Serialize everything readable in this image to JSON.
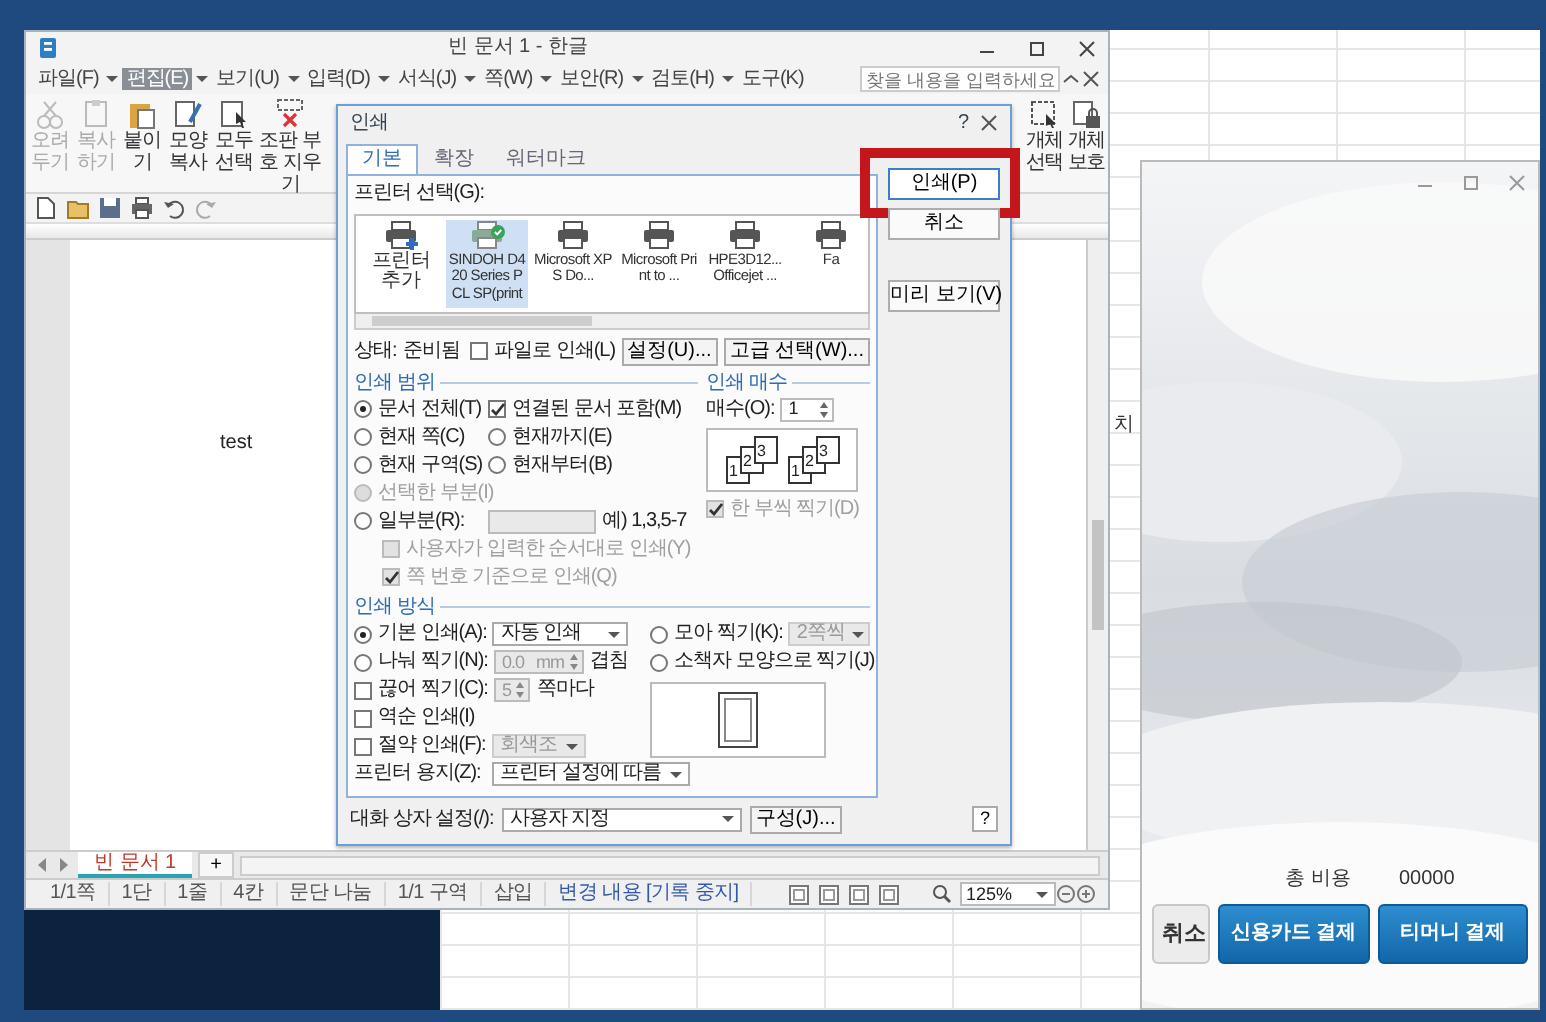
{
  "editor": {
    "title": "빈 문서 1 - 한글",
    "menu": [
      {
        "label": "파일(F)",
        "selected": false
      },
      {
        "label": "편집(E)",
        "selected": true
      },
      {
        "label": "보기(U)",
        "selected": false
      },
      {
        "label": "입력(D)",
        "selected": false
      },
      {
        "label": "서식(J)",
        "selected": false
      },
      {
        "label": "쪽(W)",
        "selected": false
      },
      {
        "label": "보안(R)",
        "selected": false
      },
      {
        "label": "검토(H)",
        "selected": false
      },
      {
        "label": "도구(K)",
        "selected": false
      }
    ],
    "search": {
      "placeholder": "찾을 내용을 입력하세요"
    },
    "ribbon_left": [
      {
        "label": "오려 두기",
        "disabled": true
      },
      {
        "label": "복사하기",
        "disabled": true
      },
      {
        "label": "붙이기",
        "disabled": false
      },
      {
        "label": "모양 복사",
        "disabled": false
      },
      {
        "label": "모두 선택",
        "disabled": false
      },
      {
        "label": "조판 부호 지우기",
        "disabled": false
      }
    ],
    "ribbon_right": [
      {
        "label": "개체 선택",
        "disabled": false
      },
      {
        "label": "개체 보호",
        "disabled": false
      }
    ],
    "document_text": "test",
    "doc_tabs": [
      {
        "label": "빈 문서 1",
        "selected": true
      }
    ],
    "new_tab_button": "+",
    "status_bar": [
      "1/1쪽",
      "1단",
      "1줄",
      "4칸",
      "문단 나눔",
      "1/1 구역",
      "삽입",
      "변경 내용 [기록 중지]"
    ],
    "zoom": "125%"
  },
  "print_dialog": {
    "title": "인쇄",
    "title_help": "?",
    "tabs": [
      {
        "label": "기본",
        "selected": true
      },
      {
        "label": "확장",
        "selected": false
      },
      {
        "label": "워터마크",
        "selected": false
      }
    ],
    "buttons": [
      {
        "label": "인쇄(P)",
        "highlighted": true
      },
      {
        "label": "취소",
        "highlighted": false
      },
      {
        "label": "미리 보기(V)",
        "highlighted": false
      }
    ],
    "printer_label": "프린터 선택(G):",
    "printers": [
      {
        "name": "프린터 추가",
        "kind": "add",
        "selected": false
      },
      {
        "name": "SINDOH D420 Series PCL SP(print",
        "kind": "printer",
        "default": true,
        "selected": true
      },
      {
        "name": "Microsoft XPS Do...",
        "kind": "printer",
        "default": false,
        "selected": false
      },
      {
        "name": "Microsoft Print to ...",
        "kind": "printer",
        "default": false,
        "selected": false
      },
      {
        "name": "HPE3D12... Officejet ...",
        "kind": "printer",
        "default": false,
        "selected": false
      },
      {
        "name": "Fa",
        "kind": "printer",
        "default": false,
        "selected": false
      }
    ],
    "status_label": "상태:",
    "status_value": "준비됨",
    "print_to_file": {
      "label": "파일로 인쇄(L)",
      "checked": false
    },
    "setup_buttons": [
      "설정(U)...",
      "고급 선택(W)..."
    ],
    "range": {
      "title": "인쇄 범위",
      "rows": [
        {
          "items": [
            {
              "kind": "radio",
              "label": "문서 전체(T)",
              "checked": true,
              "disabled": false
            },
            {
              "kind": "checkbox",
              "label": "연결된 문서 포함(M)",
              "checked": true,
              "disabled": false
            }
          ]
        },
        {
          "items": [
            {
              "kind": "radio",
              "label": "현재 쪽(C)",
              "checked": false,
              "disabled": false
            },
            {
              "kind": "radio",
              "label": "현재까지(E)",
              "checked": false,
              "disabled": false
            }
          ]
        },
        {
          "items": [
            {
              "kind": "radio",
              "label": "현재 구역(S)",
              "checked": false,
              "disabled": false
            },
            {
              "kind": "radio",
              "label": "현재부터(B)",
              "checked": false,
              "disabled": false
            }
          ]
        },
        {
          "items": [
            {
              "kind": "radio",
              "label": "선택한 부분(I)",
              "checked": false,
              "disabled": true
            }
          ]
        },
        {
          "items": [
            {
              "kind": "radio",
              "label": "일부분(R):",
              "checked": false,
              "disabled": false
            },
            {
              "kind": "field",
              "disabled": true
            },
            {
              "kind": "text",
              "label": "예) 1,3,5-7"
            }
          ],
          "children": [
            {
              "items": [
                {
                  "kind": "checkbox",
                  "label": "사용자가 입력한 순서대로 인쇄(Y)",
                  "checked": false,
                  "disabled": true
                }
              ]
            },
            {
              "items": [
                {
                  "kind": "checkbox",
                  "label": "쪽 번호 기준으로 인쇄(Q)",
                  "checked": true,
                  "disabled": true
                }
              ]
            }
          ]
        }
      ]
    },
    "copies": {
      "title": "인쇄 매수",
      "label": "매수(O):",
      "value": "1",
      "collate_sets": [
        [
          "1",
          "2",
          "3"
        ],
        [
          "1",
          "2",
          "3"
        ]
      ],
      "collate": {
        "label": "한 부씩 찍기(D)",
        "checked": true,
        "disabled": true
      }
    },
    "method": {
      "title": "인쇄 방식",
      "left_rows": [
        {
          "items": [
            {
              "kind": "radio",
              "label": "기본 인쇄(A):",
              "checked": true,
              "disabled": false
            },
            {
              "kind": "select",
              "value": "자동 인쇄",
              "disabled": false
            }
          ]
        },
        {
          "items": [
            {
              "kind": "radio",
              "label": "나눠 찍기(N):",
              "checked": false,
              "disabled": false
            },
            {
              "kind": "spin",
              "value": "0.0",
              "unit": "mm",
              "disabled": true
            },
            {
              "kind": "text",
              "label": "겹침"
            }
          ]
        },
        {
          "items": [
            {
              "kind": "checkbox",
              "label": "끊어 찍기(C):",
              "checked": false,
              "disabled": false
            },
            {
              "kind": "spin",
              "value": "5",
              "disabled": true
            },
            {
              "kind": "text",
              "label": "쪽마다"
            }
          ]
        },
        {
          "items": [
            {
              "kind": "checkbox",
              "label": "역순 인쇄(I)",
              "checked": false,
              "disabled": false
            }
          ]
        },
        {
          "items": [
            {
              "kind": "checkbox",
              "label": "절약 인쇄(F):",
              "checked": false,
              "disabled": false
            },
            {
              "kind": "select",
              "value": "회색조",
              "disabled": true
            }
          ]
        },
        {
          "items": [
            {
              "kind": "text",
              "label": "프린터 용지(Z):"
            },
            {
              "kind": "select",
              "value": "프린터 설정에 따름",
              "disabled": false
            }
          ]
        }
      ],
      "right_rows": [
        {
          "items": [
            {
              "kind": "radio",
              "label": "모아 찍기(K):",
              "checked": false,
              "disabled": false
            },
            {
              "kind": "select",
              "value": "2쪽씩",
              "disabled": true
            }
          ]
        },
        {
          "items": [
            {
              "kind": "radio",
              "label": "소책자 모양으로 찍기(J)",
              "checked": false,
              "disabled": false
            }
          ]
        }
      ]
    },
    "dialog_settings": {
      "label": "대화 상자 설정(/):",
      "value": "사용자 지정"
    },
    "configure_button": "구성(J)...",
    "help_button": "?"
  },
  "back_window": {
    "column_header": "치"
  },
  "payment": {
    "total_label": "총 비용",
    "total_value": "00000",
    "buttons": [
      {
        "label": "취소",
        "kind": "plain"
      },
      {
        "label": "신용카드 결제",
        "kind": "primary"
      },
      {
        "label": "티머니 결제",
        "kind": "primary"
      }
    ]
  }
}
